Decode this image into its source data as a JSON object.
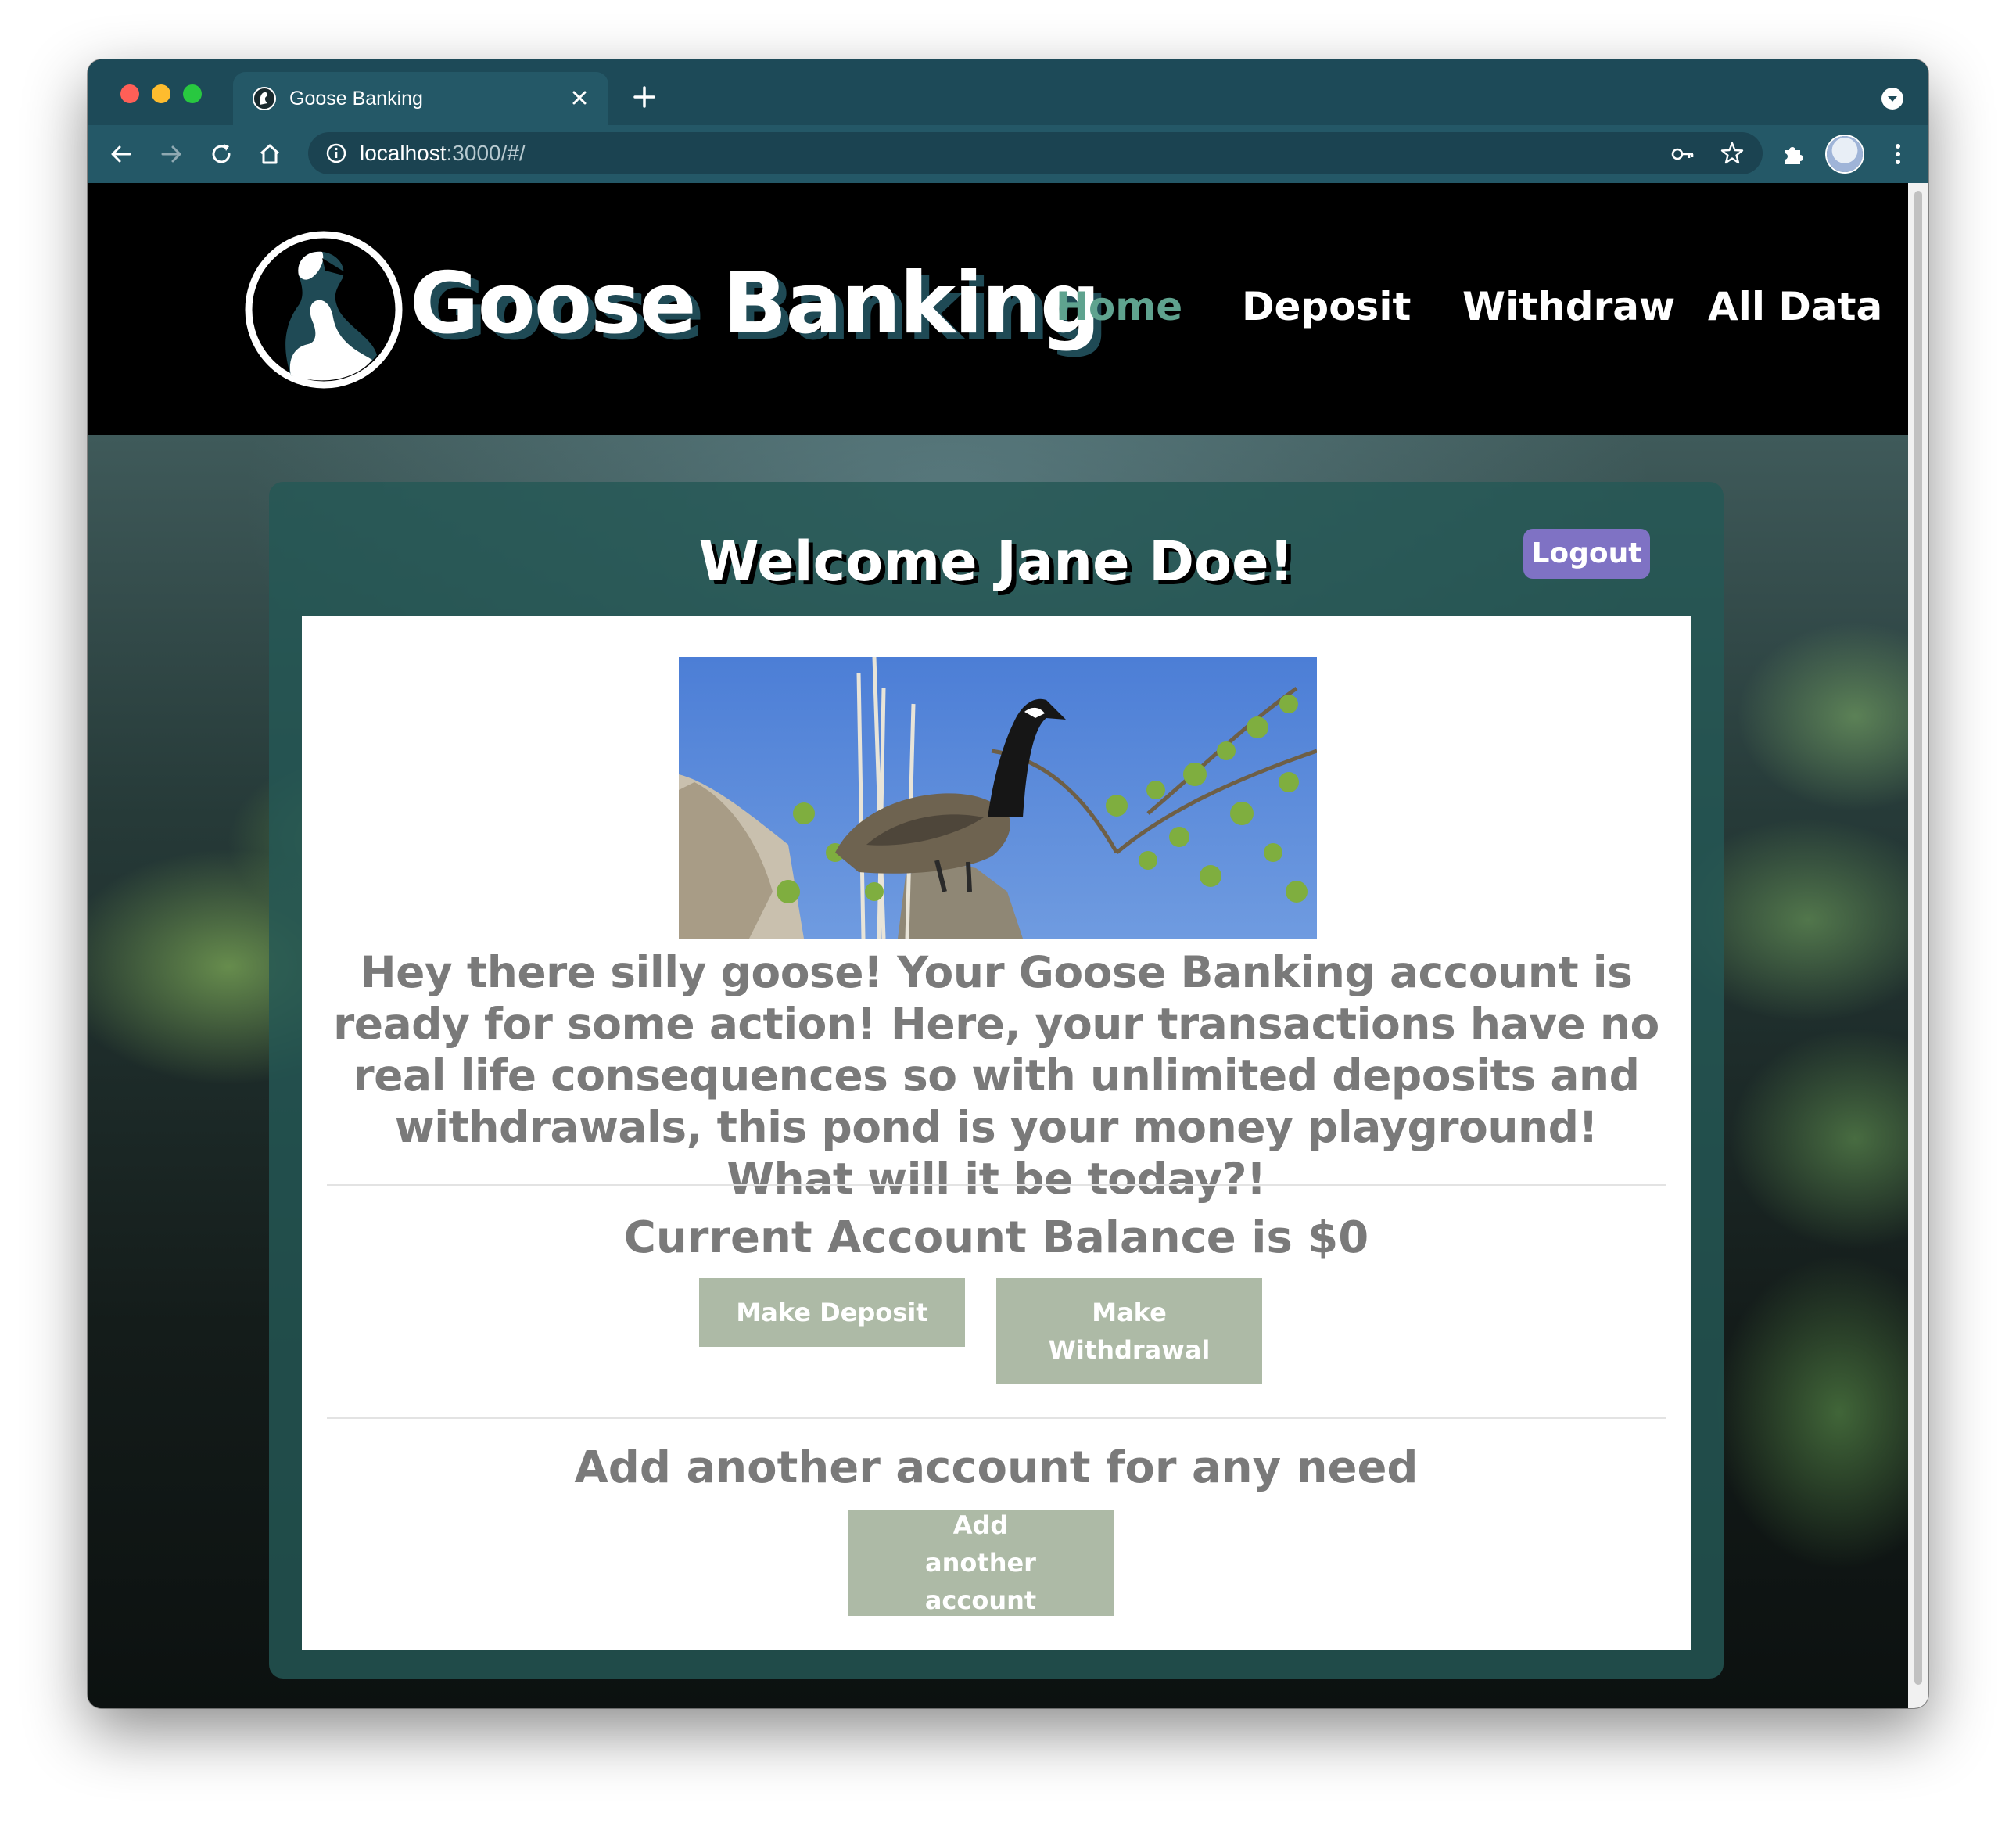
{
  "browser": {
    "tab_title": "Goose Banking",
    "url_host": "localhost",
    "url_path": ":3000/#/"
  },
  "nav": {
    "brand": "Goose Banking",
    "links": [
      {
        "label": "Home",
        "active": true
      },
      {
        "label": "Deposit",
        "active": false
      },
      {
        "label": "Withdraw",
        "active": false
      },
      {
        "label": "All Data",
        "active": false
      }
    ]
  },
  "card": {
    "welcome": "Welcome Jane Doe!",
    "logout_label": "Logout",
    "intro_text": "Hey there silly goose! Your Goose Banking account is ready for some action! Here, your transactions have no real life consequences so with unlimited deposits and withdrawals, this pond is your money playground! What will it be today?!",
    "balance_text": "Current Account Balance is $0",
    "deposit_label": "Make Deposit",
    "withdraw_label": "Make Withdrawal",
    "another_heading": "Add another account for any need",
    "another_label": "Add another account"
  },
  "icons": {
    "back": "arrow-left-icon",
    "forward": "arrow-right-icon",
    "reload": "reload-icon",
    "home": "home-icon",
    "info": "info-icon",
    "key": "key-icon",
    "star": "star-icon",
    "extensions": "puzzle-icon",
    "menu": "kebab-icon"
  },
  "colors": {
    "chrome_dark": "#1d4a58",
    "chrome_light": "#245867",
    "nav_active": "#5fa38f",
    "logout": "#7f72c4",
    "button": "#adbaa6",
    "card": "#255856"
  }
}
